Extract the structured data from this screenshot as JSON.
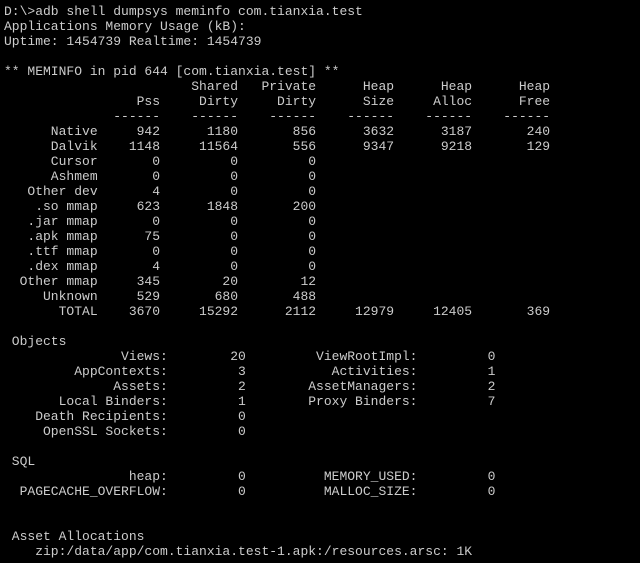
{
  "prompt": "D:\\>adb shell dumpsys meminfo com.tianxia.test",
  "hdr1": "Applications Memory Usage (kB):",
  "hdr2": "Uptime: 1454739 Realtime: 1454739",
  "memTitle": "** MEMINFO in pid 644 [com.tianxia.test] **",
  "cols": {
    "c1": "Pss",
    "c2": "Shared",
    "c2b": "Dirty",
    "c3": "Private",
    "c3b": "Dirty",
    "c4": "Heap",
    "c4b": "Size",
    "c5": "Heap",
    "c5b": "Alloc",
    "c6": "Heap",
    "c6b": "Free"
  },
  "rows": [
    {
      "n": "Native",
      "v": [
        "942",
        "1180",
        "856",
        "3632",
        "3187",
        "240"
      ]
    },
    {
      "n": "Dalvik",
      "v": [
        "1148",
        "11564",
        "556",
        "9347",
        "9218",
        "129"
      ]
    },
    {
      "n": "Cursor",
      "v": [
        "0",
        "0",
        "0",
        "",
        "",
        ""
      ]
    },
    {
      "n": "Ashmem",
      "v": [
        "0",
        "0",
        "0",
        "",
        "",
        ""
      ]
    },
    {
      "n": "Other dev",
      "v": [
        "4",
        "0",
        "0",
        "",
        "",
        ""
      ]
    },
    {
      "n": ".so mmap",
      "v": [
        "623",
        "1848",
        "200",
        "",
        "",
        ""
      ]
    },
    {
      "n": ".jar mmap",
      "v": [
        "0",
        "0",
        "0",
        "",
        "",
        ""
      ]
    },
    {
      "n": ".apk mmap",
      "v": [
        "75",
        "0",
        "0",
        "",
        "",
        ""
      ]
    },
    {
      "n": ".ttf mmap",
      "v": [
        "0",
        "0",
        "0",
        "",
        "",
        ""
      ]
    },
    {
      "n": ".dex mmap",
      "v": [
        "4",
        "0",
        "0",
        "",
        "",
        ""
      ]
    },
    {
      "n": "Other mmap",
      "v": [
        "345",
        "20",
        "12",
        "",
        "",
        ""
      ]
    },
    {
      "n": "Unknown",
      "v": [
        "529",
        "680",
        "488",
        "",
        "",
        ""
      ]
    },
    {
      "n": "TOTAL",
      "v": [
        "3670",
        "15292",
        "2112",
        "12979",
        "12405",
        "369"
      ]
    }
  ],
  "objectsTitle": "Objects",
  "objects": [
    {
      "l": "Views:",
      "v": "20",
      "r": "ViewRootImpl:",
      "rv": "0"
    },
    {
      "l": "AppContexts:",
      "v": "3",
      "r": "Activities:",
      "rv": "1"
    },
    {
      "l": "Assets:",
      "v": "2",
      "r": "AssetManagers:",
      "rv": "2"
    },
    {
      "l": "Local Binders:",
      "v": "1",
      "r": "Proxy Binders:",
      "rv": "7"
    },
    {
      "l": "Death Recipients:",
      "v": "0",
      "r": "",
      "rv": ""
    },
    {
      "l": "OpenSSL Sockets:",
      "v": "0",
      "r": "",
      "rv": ""
    }
  ],
  "sqlTitle": "SQL",
  "sql": [
    {
      "l": "heap:",
      "v": "0",
      "r": "MEMORY_USED:",
      "rv": "0"
    },
    {
      "l": "PAGECACHE_OVERFLOW:",
      "v": "0",
      "r": "MALLOC_SIZE:",
      "rv": "0"
    }
  ],
  "assetTitle": "Asset Allocations",
  "assetLine": "    zip:/data/app/com.tianxia.test-1.apk:/resources.arsc: 1K"
}
